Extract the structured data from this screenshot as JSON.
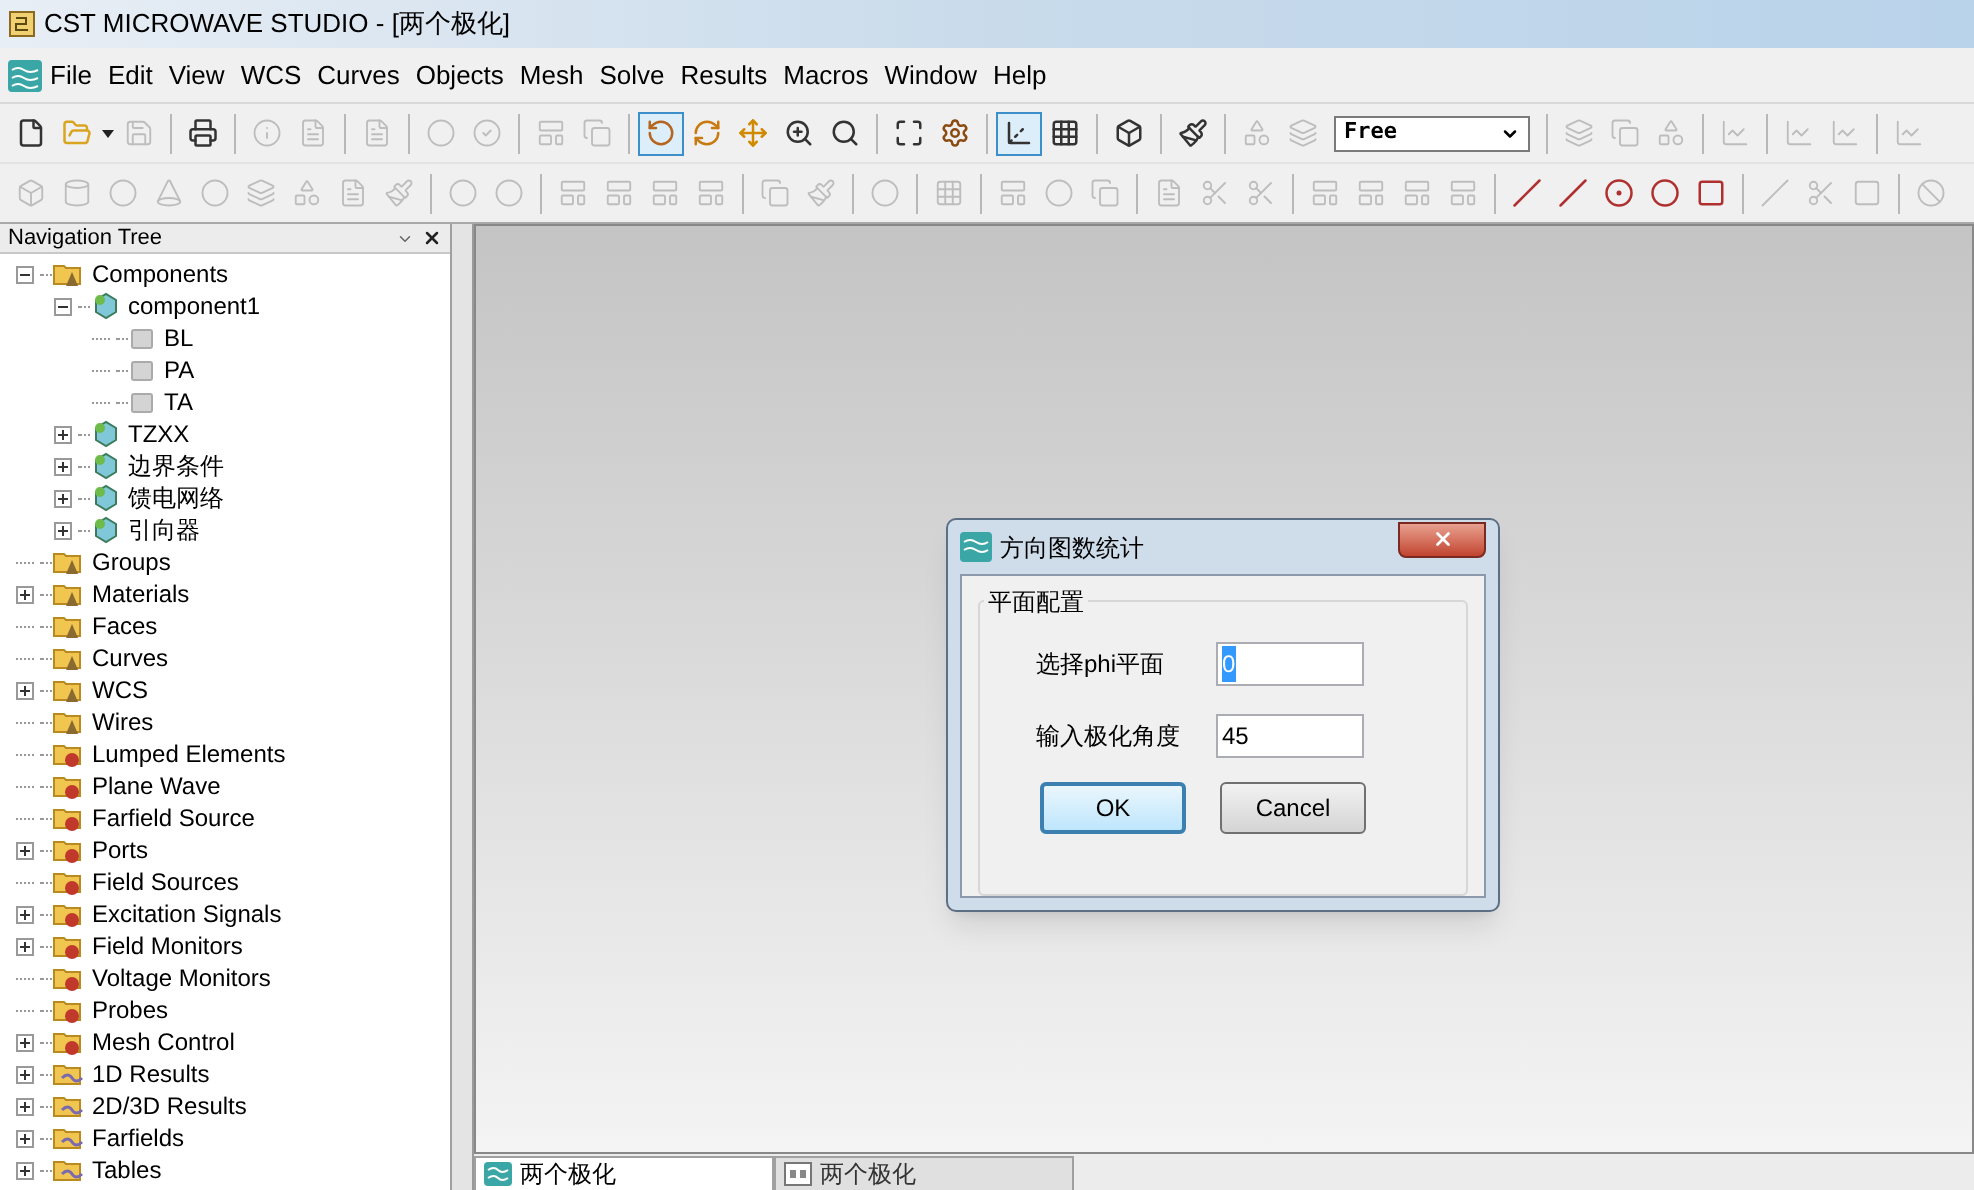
{
  "window": {
    "title": "CST MICROWAVE STUDIO - [两个极化]"
  },
  "menu": [
    "File",
    "Edit",
    "View",
    "WCS",
    "Curves",
    "Objects",
    "Mesh",
    "Solve",
    "Results",
    "Macros",
    "Window",
    "Help"
  ],
  "toolbar_1": [
    {
      "kind": "file",
      "disabled": false,
      "pressed": false
    },
    {
      "kind": "folder",
      "disabled": false,
      "pressed": false
    },
    {
      "kind": "dropdown",
      "disabled": false
    },
    {
      "kind": "save",
      "disabled": true,
      "pressed": false
    },
    {
      "kind": "sep"
    },
    {
      "kind": "print",
      "disabled": false,
      "pressed": false
    },
    {
      "kind": "sep"
    },
    {
      "kind": "info",
      "disabled": true,
      "pressed": false
    },
    {
      "kind": "doc",
      "disabled": true,
      "pressed": false
    },
    {
      "kind": "sep"
    },
    {
      "kind": "doc",
      "disabled": true,
      "pressed": false
    },
    {
      "kind": "sep"
    },
    {
      "kind": "circle",
      "disabled": true,
      "pressed": false
    },
    {
      "kind": "check",
      "disabled": true,
      "pressed": false
    },
    {
      "kind": "sep"
    },
    {
      "kind": "layout",
      "disabled": true,
      "pressed": false
    },
    {
      "kind": "copy",
      "disabled": true,
      "pressed": false
    },
    {
      "kind": "sep"
    },
    {
      "kind": "rotate",
      "disabled": false,
      "pressed": true
    },
    {
      "kind": "spin",
      "disabled": false,
      "pressed": false
    },
    {
      "kind": "move",
      "disabled": false,
      "pressed": false
    },
    {
      "kind": "zoom",
      "disabled": false,
      "pressed": false
    },
    {
      "kind": "zoomarea",
      "disabled": false,
      "pressed": false
    },
    {
      "kind": "sep"
    },
    {
      "kind": "fit",
      "disabled": false,
      "pressed": false
    },
    {
      "kind": "gear",
      "disabled": false,
      "pressed": false
    },
    {
      "kind": "sep"
    },
    {
      "kind": "axes",
      "disabled": false,
      "pressed": true
    },
    {
      "kind": "grid",
      "disabled": false,
      "pressed": false
    },
    {
      "kind": "sep"
    },
    {
      "kind": "cube",
      "disabled": false,
      "pressed": false
    },
    {
      "kind": "sep"
    },
    {
      "kind": "brush",
      "disabled": false,
      "pressed": false
    },
    {
      "kind": "sep"
    },
    {
      "kind": "shapes",
      "disabled": true,
      "pressed": false
    },
    {
      "kind": "layers",
      "disabled": true,
      "pressed": false
    },
    {
      "kind": "combo",
      "value": "Free"
    },
    {
      "kind": "sep"
    },
    {
      "kind": "layers",
      "disabled": true,
      "pressed": false
    },
    {
      "kind": "copy",
      "disabled": true,
      "pressed": false
    },
    {
      "kind": "shapes",
      "disabled": true,
      "pressed": false
    },
    {
      "kind": "sep"
    },
    {
      "kind": "chart",
      "disabled": true,
      "pressed": false
    },
    {
      "kind": "sep"
    },
    {
      "kind": "chart",
      "disabled": true,
      "pressed": false
    },
    {
      "kind": "chart",
      "disabled": true,
      "pressed": false
    },
    {
      "kind": "sep"
    },
    {
      "kind": "chart",
      "disabled": true,
      "pressed": false
    }
  ],
  "toolbar_2": [
    {
      "kind": "box",
      "disabled": true
    },
    {
      "kind": "cylinder",
      "disabled": true
    },
    {
      "kind": "circle",
      "disabled": true
    },
    {
      "kind": "cone",
      "disabled": true
    },
    {
      "kind": "circle",
      "disabled": true
    },
    {
      "kind": "layers",
      "disabled": true
    },
    {
      "kind": "shapes",
      "disabled": true
    },
    {
      "kind": "doc",
      "disabled": true
    },
    {
      "kind": "brush",
      "disabled": true
    },
    {
      "kind": "sep"
    },
    {
      "kind": "circle",
      "disabled": true
    },
    {
      "kind": "circle",
      "disabled": true
    },
    {
      "kind": "sep"
    },
    {
      "kind": "layout",
      "disabled": true
    },
    {
      "kind": "layout",
      "disabled": true
    },
    {
      "kind": "layout",
      "disabled": true
    },
    {
      "kind": "layout",
      "disabled": true
    },
    {
      "kind": "sep"
    },
    {
      "kind": "copy",
      "disabled": true
    },
    {
      "kind": "brush",
      "disabled": true
    },
    {
      "kind": "sep"
    },
    {
      "kind": "circle",
      "disabled": true
    },
    {
      "kind": "sep"
    },
    {
      "kind": "grid",
      "disabled": true
    },
    {
      "kind": "sep"
    },
    {
      "kind": "layout",
      "disabled": true
    },
    {
      "kind": "circle",
      "disabled": true
    },
    {
      "kind": "copy",
      "disabled": true
    },
    {
      "kind": "sep"
    },
    {
      "kind": "doc",
      "disabled": true
    },
    {
      "kind": "scissors",
      "disabled": true
    },
    {
      "kind": "scissors",
      "disabled": true
    },
    {
      "kind": "sep"
    },
    {
      "kind": "layout",
      "disabled": true
    },
    {
      "kind": "layout",
      "disabled": true
    },
    {
      "kind": "layout",
      "disabled": true
    },
    {
      "kind": "layout",
      "disabled": true
    },
    {
      "kind": "sep"
    },
    {
      "kind": "segment",
      "disabled": false
    },
    {
      "kind": "segment",
      "disabled": false
    },
    {
      "kind": "target",
      "disabled": false
    },
    {
      "kind": "arc",
      "disabled": false
    },
    {
      "kind": "face",
      "disabled": false
    },
    {
      "kind": "sep"
    },
    {
      "kind": "line",
      "disabled": true
    },
    {
      "kind": "scissors",
      "disabled": true
    },
    {
      "kind": "square",
      "disabled": true
    },
    {
      "kind": "sep"
    },
    {
      "kind": "ban",
      "disabled": true
    }
  ],
  "navigation_tree": {
    "title": "Navigation Tree",
    "items": [
      {
        "label": "Components",
        "kind": "folder-cone",
        "expanded": true,
        "children": [
          {
            "label": "component1",
            "kind": "component",
            "expanded": true,
            "children": [
              {
                "label": "BL",
                "kind": "solid"
              },
              {
                "label": "PA",
                "kind": "solid"
              },
              {
                "label": "TA",
                "kind": "solid"
              }
            ]
          },
          {
            "label": "TZXX",
            "kind": "component",
            "expanded": false
          },
          {
            "label": "边界条件",
            "kind": "component",
            "expanded": false
          },
          {
            "label": "馈电网络",
            "kind": "component",
            "expanded": false
          },
          {
            "label": "引向器",
            "kind": "component",
            "expanded": false
          }
        ]
      },
      {
        "label": "Groups",
        "kind": "folder-cone"
      },
      {
        "label": "Materials",
        "kind": "folder-cone",
        "expanded": false
      },
      {
        "label": "Faces",
        "kind": "folder-cone"
      },
      {
        "label": "Curves",
        "kind": "folder-cone"
      },
      {
        "label": "WCS",
        "kind": "folder-cone",
        "expanded": false
      },
      {
        "label": "Wires",
        "kind": "folder-cone"
      },
      {
        "label": "Lumped Elements",
        "kind": "folder-gear"
      },
      {
        "label": "Plane Wave",
        "kind": "folder-gear"
      },
      {
        "label": "Farfield Source",
        "kind": "folder-gear"
      },
      {
        "label": "Ports",
        "kind": "folder-gear",
        "expanded": false
      },
      {
        "label": "Field Sources",
        "kind": "folder-gear"
      },
      {
        "label": "Excitation Signals",
        "kind": "folder-gear",
        "expanded": false
      },
      {
        "label": "Field Monitors",
        "kind": "folder-gear",
        "expanded": false
      },
      {
        "label": "Voltage Monitors",
        "kind": "folder-gear"
      },
      {
        "label": "Probes",
        "kind": "folder-gear"
      },
      {
        "label": "Mesh Control",
        "kind": "folder-gear",
        "expanded": false
      },
      {
        "label": "1D Results",
        "kind": "folder-wave",
        "expanded": false
      },
      {
        "label": "2D/3D Results",
        "kind": "folder-wave",
        "expanded": false
      },
      {
        "label": "Farfields",
        "kind": "folder-wave",
        "expanded": false
      },
      {
        "label": "Tables",
        "kind": "folder-wave",
        "expanded": false
      }
    ]
  },
  "dialog": {
    "title": "方向图数统计",
    "group": "平面配置",
    "fields": [
      {
        "label": "选择phi平面",
        "value": "0",
        "selected": true
      },
      {
        "label": "输入极化角度",
        "value": "45",
        "selected": false
      }
    ],
    "buttons": [
      {
        "label": "OK",
        "default": true
      },
      {
        "label": "Cancel",
        "default": false
      }
    ]
  },
  "document_tabs": [
    {
      "label": "两个极化",
      "kind": "app",
      "selected": true
    },
    {
      "label": "两个极化",
      "kind": "schematic",
      "selected": false
    }
  ]
}
